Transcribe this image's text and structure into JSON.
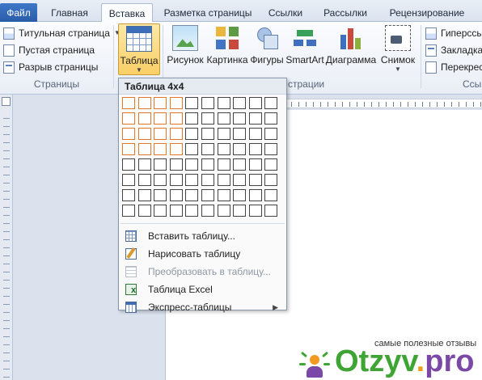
{
  "tabs": {
    "file": "Файл",
    "items": [
      "Главная",
      "Вставка",
      "Разметка страницы",
      "Ссылки",
      "Рассылки",
      "Рецензирование"
    ],
    "active": "Вставка"
  },
  "ribbon": {
    "pages_group": {
      "cover_page": "Титульная страница",
      "blank_page": "Пустая страница",
      "page_break": "Разрыв страницы",
      "label": "Страницы"
    },
    "table_button": "Таблица",
    "picture": "Рисунок",
    "clipart": "Картинка",
    "shapes": "Фигуры",
    "smartart": "SmartArt",
    "chart": "Диаграмма",
    "screenshot": "Снимок",
    "illustrations_label_partial": "страции",
    "links_group": {
      "hyperlink": "Гиперссы",
      "bookmark": "Закладка",
      "crossref": "Перекрес",
      "label": "Ссы"
    }
  },
  "table_menu": {
    "title": "Таблица 4x4",
    "grid_columns": 10,
    "grid_rows": 8,
    "selected_columns": 4,
    "selected_rows": 4,
    "items": [
      {
        "label": "Вставить таблицу...",
        "disabled": false,
        "icon": "insert-table-icon"
      },
      {
        "label": "Нарисовать таблицу",
        "disabled": false,
        "icon": "draw-table-icon"
      },
      {
        "label": "Преобразовать в таблицу...",
        "disabled": true,
        "icon": "convert-table-icon"
      },
      {
        "label": "Таблица Excel",
        "disabled": false,
        "icon": "excel-table-icon"
      },
      {
        "label": "Экспресс-таблицы",
        "disabled": false,
        "icon": "quick-tables-icon"
      }
    ]
  },
  "watermark": {
    "caption": "самые полезные отзывы",
    "logo_main": "Otzyv",
    "logo_dot": ".",
    "logo_tld": "pro"
  },
  "colors": {
    "selected_cell_border": "#e07a2a",
    "file_tab": "#2a5aa6"
  }
}
